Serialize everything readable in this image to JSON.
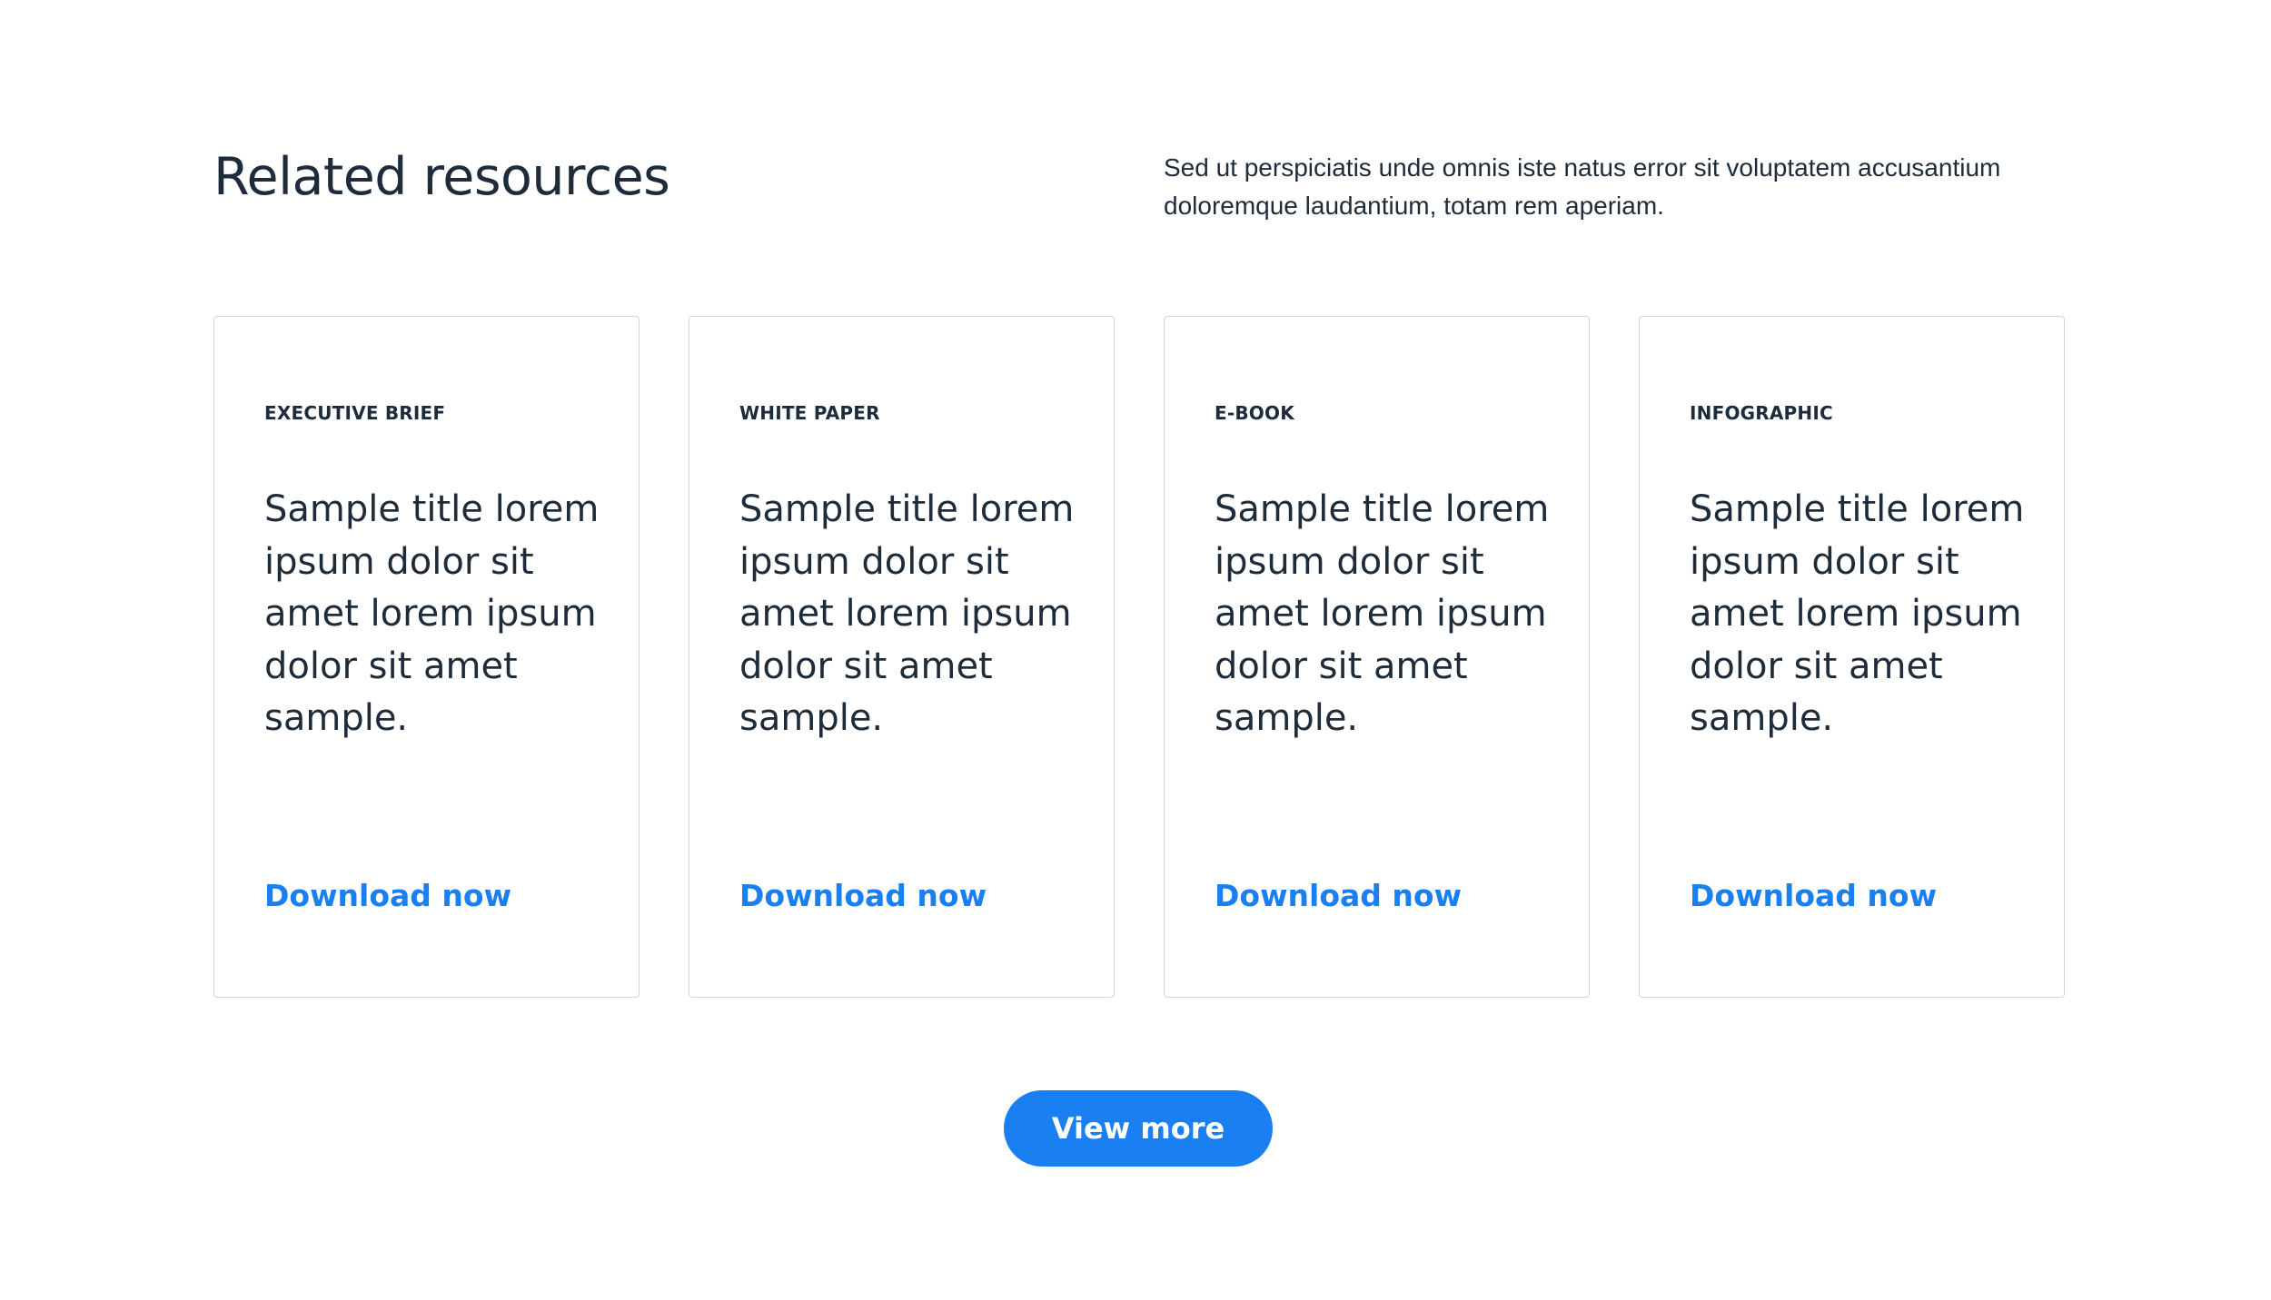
{
  "header": {
    "title": "Related resources",
    "description": "Sed ut perspiciatis unde omnis iste natus error sit voluptatem accusantium doloremque laudantium, totam rem aperiam."
  },
  "cards": [
    {
      "type": "EXECUTIVE BRIEF",
      "title": "Sample title lorem ipsum dolor sit amet lorem ipsum dolor sit amet sample.",
      "link_label": "Download now"
    },
    {
      "type": "WHITE PAPER",
      "title": "Sample title lorem ipsum dolor sit amet lorem ipsum dolor sit amet sample.",
      "link_label": "Download now"
    },
    {
      "type": "E-BOOK",
      "title": "Sample title lorem ipsum dolor sit amet lorem ipsum dolor sit amet sample.",
      "link_label": "Download now"
    },
    {
      "type": "INFOGRAPHIC",
      "title": "Sample title lorem ipsum dolor sit amet lorem ipsum dolor sit amet sample.",
      "link_label": "Download now"
    }
  ],
  "footer": {
    "view_more_label": "View more"
  },
  "colors": {
    "text": "#1d2b3a",
    "accent": "#1a7ff0",
    "card_border": "#d3d7dc",
    "background": "#ffffff"
  }
}
